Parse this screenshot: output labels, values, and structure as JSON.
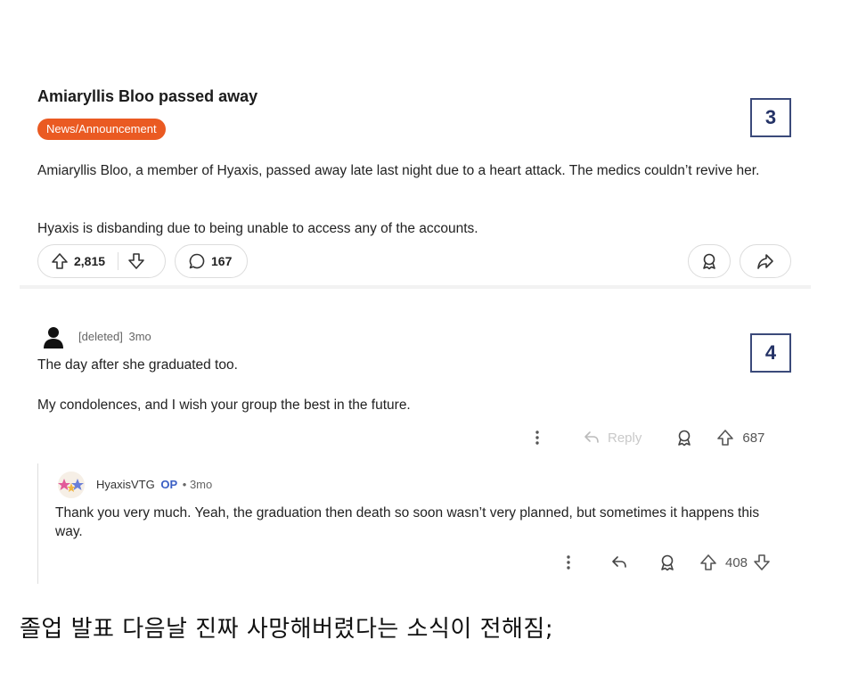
{
  "post": {
    "title": "Amiaryllis Bloo passed away",
    "flair": "News/Announcement",
    "paragraph1": "Amiaryllis Bloo, a member of Hyaxis, passed away late last night due to a heart attack. The medics couldn’t revive her.",
    "paragraph2": "Hyaxis is disbanding due to being unable to access any of the accounts.",
    "upvotes": "2,815",
    "comments": "167",
    "marker": "3"
  },
  "comment1": {
    "author": "[deleted]",
    "age": "3mo",
    "line1": "The day after she graduated too.",
    "line2": "My condolences, and I wish your group the best in the future.",
    "reply_label": "Reply",
    "score": "687",
    "marker": "4"
  },
  "comment2": {
    "author": "HyaxisVTG",
    "op_label": "OP",
    "age": "• 3mo",
    "text": "Thank you very much. Yeah, the graduation then death so soon wasn’t very planned, but sometimes it happens this way.",
    "score": "408"
  },
  "caption": "졸업 발표 다음날 진짜 사망해버렸다는 소식이 전해짐;",
  "colors": {
    "flair_bg": "#ea5a22",
    "op_blue": "#3b5fc4",
    "marker_border": "#3b4a7a"
  },
  "icons": [
    "upvote-icon",
    "downvote-icon",
    "comment-icon",
    "award-icon",
    "share-icon",
    "more-icon",
    "reply-icon",
    "user-icon"
  ]
}
